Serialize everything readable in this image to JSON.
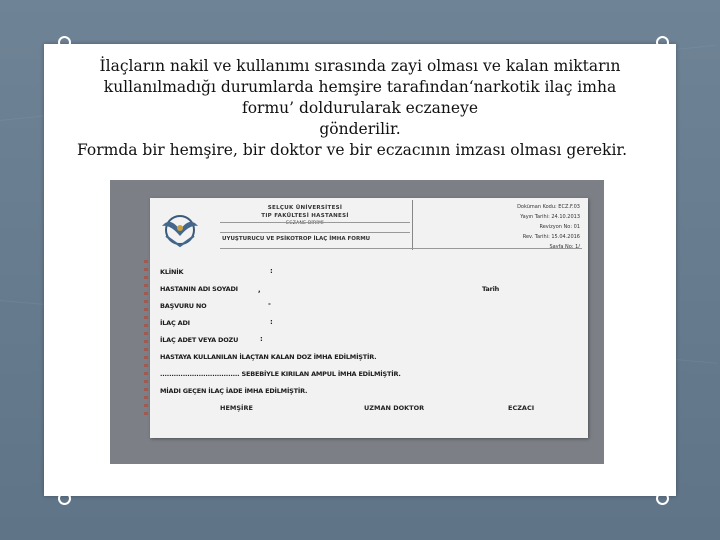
{
  "caption": {
    "line1": "İlaçların nakil ve kullanımı sırasında zayi olması ve kalan miktarın",
    "line2": "kullanılmadığı durumlarda  hemşire tarafından‘narkotik ilaç imha",
    "line3": "formu’ doldurularak  eczaneye",
    "line4": "gönderilir.",
    "line5": "Formda bir hemşire, bir doktor ve bir eczacının imzası olması gerekir."
  },
  "form": {
    "institution": "SELÇUK ÜNİVERSİTESİ",
    "hospital": "TIP FAKÜLTESİ HASTANESİ",
    "unit": "ECZANE BİRİMİ",
    "title": "UYUŞTURUCU VE PSİKOTROP İLAÇ İMHA FORMU",
    "doc_code": "Doküman Kodu: ECZ.F.03",
    "pub_date": "Yayın Tarihi: 24.10.2013",
    "revision_no": "Revizyon No: 01",
    "revision_date": "Rev. Tarihi: 15.04.2016",
    "page_no": "Sayfa No: 1/",
    "fields": {
      "clinic": "KLİNİK",
      "patient_name": "HASTANIN ADI SOYADI",
      "date": "Tarih",
      "protocol_no": "BAŞVURU NO",
      "drug_name": "İLAÇ ADI",
      "drug_amount": "İLAÇ ADET VEYA DOZU",
      "remaining": "HASTAYA KULLANILAN İLAÇTAN KALAN DOZ İMHA EDİLMİŞTİR.",
      "broken": "................................... SEBEBİYLE KIRILAN AMPUL İMHA EDİLMİŞTİR.",
      "unused": "MİADI GEÇEN İLAÇ İADE İMHA EDİLMİŞTİR."
    },
    "signatures": {
      "nurse": "HEMŞİRE",
      "doctor": "UZMAN DOKTOR",
      "pharmacist": "ECZACI"
    }
  },
  "colors": {
    "background": "#6f8396",
    "slide": "#ffffff",
    "photo_frame": "#7c7f86",
    "form_paper": "#f2f2f3"
  }
}
